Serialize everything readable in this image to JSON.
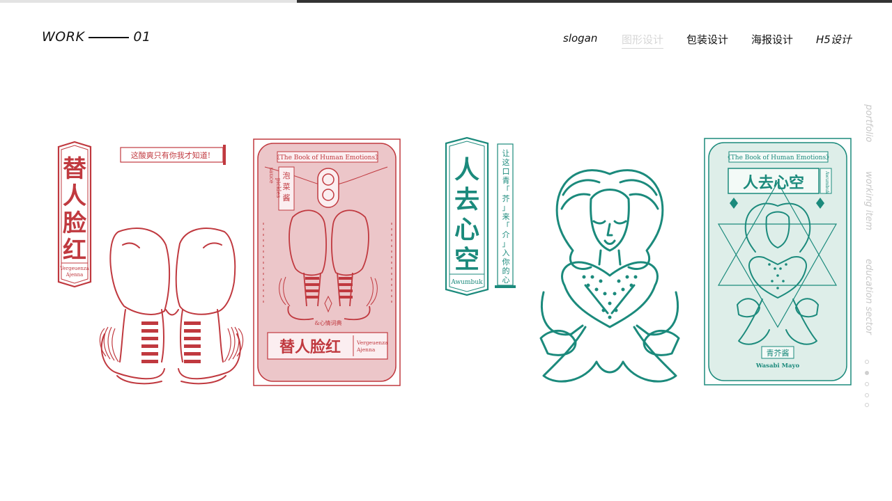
{
  "header": {
    "brand_word": "WORK",
    "brand_number": "01",
    "nav": [
      {
        "label": "slogan",
        "active": false
      },
      {
        "label": "图形设计",
        "active": true
      },
      {
        "label": "包装设计",
        "active": false
      },
      {
        "label": "海报设计",
        "active": false
      },
      {
        "label": "H5设计",
        "active": false
      }
    ]
  },
  "side_nav": [
    "portfolio",
    "working item",
    "education sector"
  ],
  "pager": {
    "count": 5,
    "active_index": 1
  },
  "colors": {
    "red": "#c0393f",
    "red_fill": "#ecc6c9",
    "teal": "#1b8a7c",
    "teal_fill": "#deeee9"
  },
  "artwork_red": {
    "title": "替人脸红",
    "subtitle_en": [
      "Vergeuenza",
      "Ajenna"
    ],
    "slogan": "这酸爽只有你我才知道!",
    "card_header": "《The Book of Human Emotions》",
    "card_tag": "泡菜酱",
    "card_vertical_en": [
      "sauce",
      "pickles"
    ],
    "card_footer_small": "&心情词典",
    "card_title": "替人脸红",
    "card_en": [
      "Vergeuenza",
      "Ajenna"
    ]
  },
  "artwork_teal": {
    "title": "人去心空",
    "subtitle_en": "Awumbuk",
    "slogan_vertical": "让这口青「芥」来「介」入你的心!",
    "card_header": "《The Book of Human Emotions》",
    "card_title": "人去心空",
    "card_side_en": "Awumbuk",
    "card_tag": "青芥酱",
    "card_en": "Wasabi Mayo"
  }
}
